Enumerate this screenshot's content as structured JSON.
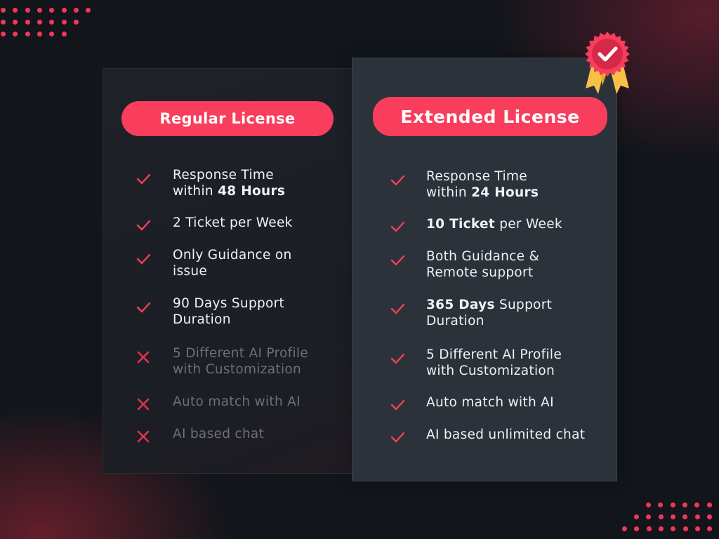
{
  "colors": {
    "accent": "#f93d5c",
    "background": "#12161b",
    "card_regular": "#1e2228",
    "card_extended": "#2c323a",
    "ribbon": "#f8c047",
    "muted_text": "#6d7077"
  },
  "regular": {
    "title": "Regular License",
    "features": [
      {
        "icon": "check-icon",
        "included": true,
        "parts": [
          [
            "Response Time",
            false
          ],
          [
            "\n",
            false
          ],
          [
            "within ",
            false
          ],
          [
            "48 Hours",
            true
          ]
        ]
      },
      {
        "icon": "check-icon",
        "included": true,
        "parts": [
          [
            "2 Ticket per Week",
            false
          ]
        ]
      },
      {
        "icon": "check-icon",
        "included": true,
        "parts": [
          [
            "Only Guidance on",
            false
          ],
          [
            "\n",
            false
          ],
          [
            "issue",
            false
          ]
        ]
      },
      {
        "icon": "check-icon",
        "included": true,
        "parts": [
          [
            "90 Days Support",
            false
          ],
          [
            "\n",
            false
          ],
          [
            "Duration",
            false
          ]
        ]
      },
      {
        "icon": "cross-icon",
        "included": false,
        "parts": [
          [
            "5 Different AI Profile",
            false
          ],
          [
            "\n",
            false
          ],
          [
            "with Customization",
            false
          ]
        ]
      },
      {
        "icon": "cross-icon",
        "included": false,
        "parts": [
          [
            "Auto match with AI",
            false
          ]
        ]
      },
      {
        "icon": "cross-icon",
        "included": false,
        "parts": [
          [
            "AI based chat",
            false
          ]
        ]
      }
    ]
  },
  "extended": {
    "title": "Extended License",
    "badge_icon": "award-ribbon-check-icon",
    "features": [
      {
        "icon": "check-icon",
        "included": true,
        "parts": [
          [
            "Response Time",
            false
          ],
          [
            "\n",
            false
          ],
          [
            "within ",
            false
          ],
          [
            "24 Hours",
            true
          ]
        ]
      },
      {
        "icon": "check-icon",
        "included": true,
        "parts": [
          [
            "10 Ticket",
            true
          ],
          [
            " per Week",
            false
          ]
        ]
      },
      {
        "icon": "check-icon",
        "included": true,
        "parts": [
          [
            "Both Guidance &",
            false
          ],
          [
            "\n",
            false
          ],
          [
            "Remote support",
            false
          ]
        ]
      },
      {
        "icon": "check-icon",
        "included": true,
        "parts": [
          [
            "365 Days",
            true
          ],
          [
            " Support",
            false
          ],
          [
            "\n",
            false
          ],
          [
            "Duration",
            false
          ]
        ]
      },
      {
        "icon": "check-icon",
        "included": true,
        "parts": [
          [
            "5 Different AI Profile",
            false
          ],
          [
            "\n",
            false
          ],
          [
            "with Customization",
            false
          ]
        ]
      },
      {
        "icon": "check-icon",
        "included": true,
        "parts": [
          [
            "Auto match with AI",
            false
          ]
        ]
      },
      {
        "icon": "check-icon",
        "included": true,
        "parts": [
          [
            "AI based unlimited chat",
            false
          ]
        ]
      }
    ]
  }
}
